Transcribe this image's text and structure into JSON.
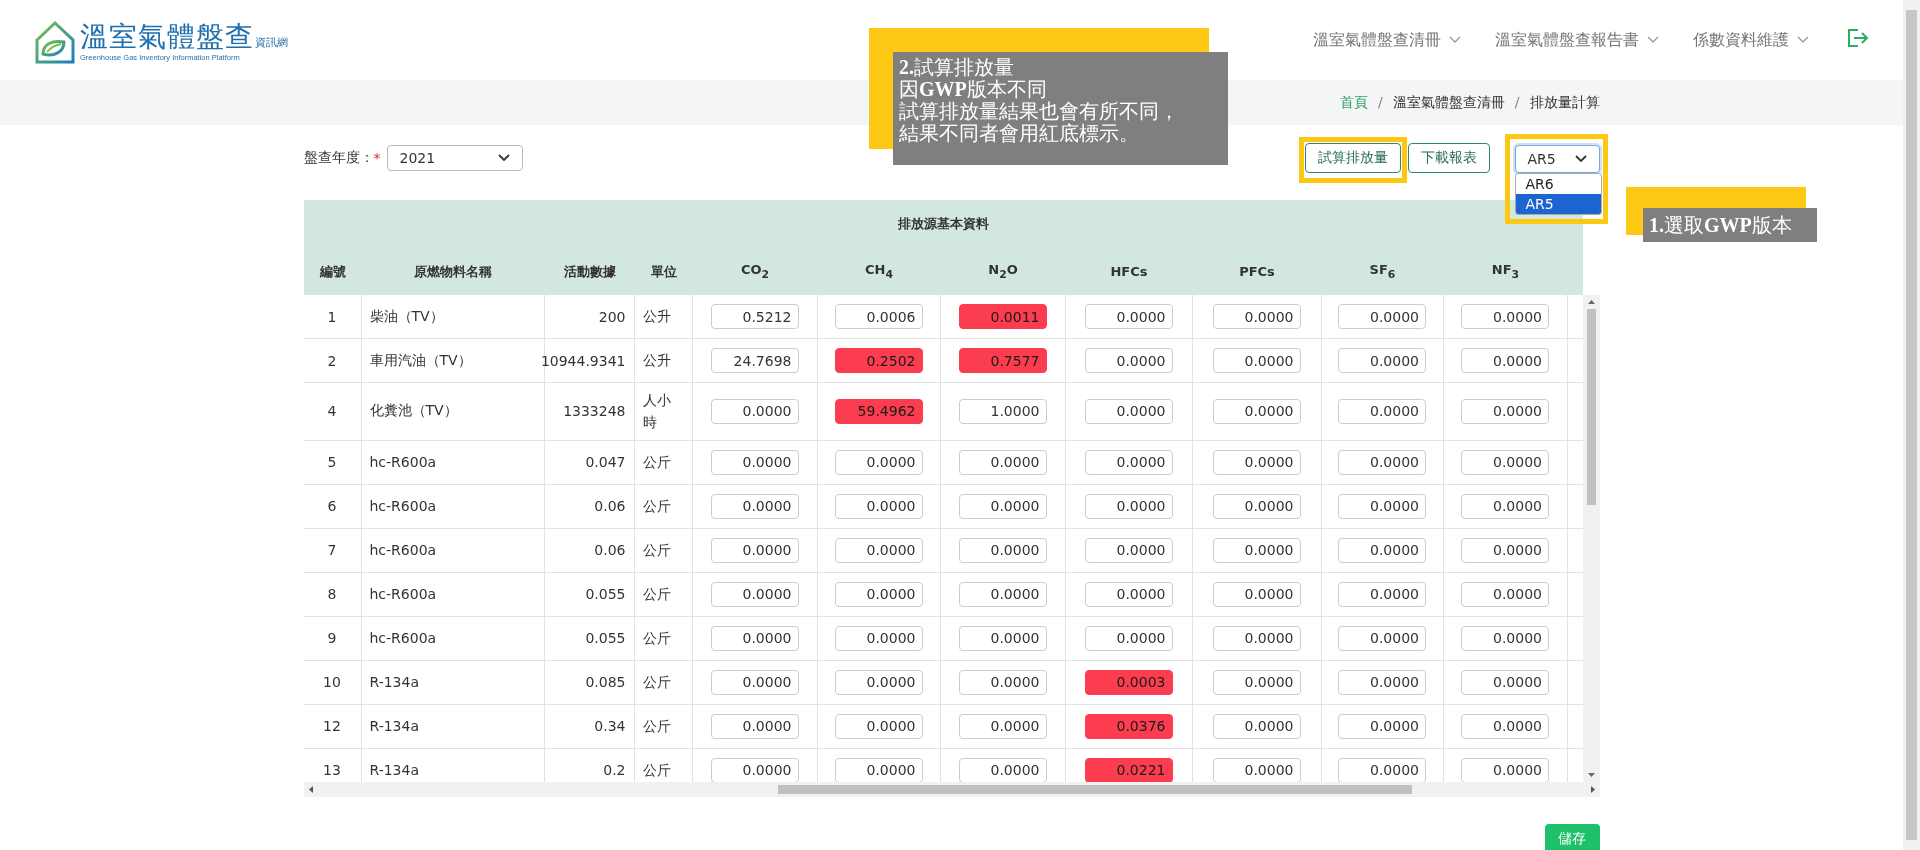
{
  "logo": {
    "title": "溫室氣體盤查",
    "suffix": "資訊網",
    "subtitle": "Greenhouse Gas Inventory Information Platform"
  },
  "nav": [
    {
      "label": "溫室氣體盤查清冊"
    },
    {
      "label": "溫室氣體盤查報告書"
    },
    {
      "label": "係數資料維護"
    }
  ],
  "breadcrumb": [
    {
      "label": "首頁",
      "link": true
    },
    {
      "label": "溫室氣體盤查清冊",
      "link": false
    },
    {
      "label": "排放量計算",
      "link": false
    }
  ],
  "separator": "/",
  "year_filter": {
    "label": "盤查年度：",
    "required_mark": "*",
    "value": "2021"
  },
  "buttons": [
    {
      "label": "試算排放量"
    },
    {
      "label": "下載報表"
    }
  ],
  "gwp_select": {
    "value": "AR5",
    "options": [
      {
        "label": "AR6",
        "selected": false
      },
      {
        "label": "AR5",
        "selected": true
      }
    ]
  },
  "annotations": [
    {
      "lines": [
        "**2.**試算排放量",
        "因**GWP**版本不同",
        "試算排放量結果也會有所不同，",
        "結果不同者會用紅底標示。"
      ]
    },
    {
      "lines": [
        "**1.**選取**GWP**版本"
      ]
    }
  ],
  "table": {
    "group_header": "排放源基本資料",
    "columns": [
      "編號",
      "原燃物料名稱",
      "活動數據",
      "單位",
      "CO$_{2}$",
      "CH$_{4}$",
      "N$_{2}$O",
      "HFCs",
      "PFCs",
      "SF$_{6}$",
      "NF$_{3}$"
    ],
    "rows": [
      {
        "no": "1",
        "material": "柴油（TV）",
        "activity": "200",
        "unit": "公升",
        "values": [
          {
            "value": "0.5212",
            "flagged": false
          },
          {
            "value": "0.0006",
            "flagged": false
          },
          {
            "value": "0.0011",
            "flagged": true
          },
          {
            "value": "0.0000",
            "flagged": false
          },
          {
            "value": "0.0000",
            "flagged": false
          },
          {
            "value": "0.0000",
            "flagged": false
          },
          {
            "value": "0.0000",
            "flagged": false
          }
        ]
      },
      {
        "no": "2",
        "material": "車用汽油（TV）",
        "activity": "10944.9341",
        "unit": "公升",
        "values": [
          {
            "value": "24.7698",
            "flagged": false
          },
          {
            "value": "0.2502",
            "flagged": true
          },
          {
            "value": "0.7577",
            "flagged": true
          },
          {
            "value": "0.0000",
            "flagged": false
          },
          {
            "value": "0.0000",
            "flagged": false
          },
          {
            "value": "0.0000",
            "flagged": false
          },
          {
            "value": "0.0000",
            "flagged": false
          }
        ]
      },
      {
        "no": "4",
        "material": "化糞池（TV）",
        "activity": "1333248",
        "unit": "人小時",
        "values": [
          {
            "value": "0.0000",
            "flagged": false
          },
          {
            "value": "59.4962",
            "flagged": true
          },
          {
            "value": "1.0000",
            "flagged": false
          },
          {
            "value": "0.0000",
            "flagged": false
          },
          {
            "value": "0.0000",
            "flagged": false
          },
          {
            "value": "0.0000",
            "flagged": false
          },
          {
            "value": "0.0000",
            "flagged": false
          }
        ]
      },
      {
        "no": "5",
        "material": "hc-R600a",
        "activity": "0.047",
        "unit": "公斤",
        "values": [
          {
            "value": "0.0000",
            "flagged": false
          },
          {
            "value": "0.0000",
            "flagged": false
          },
          {
            "value": "0.0000",
            "flagged": false
          },
          {
            "value": "0.0000",
            "flagged": false
          },
          {
            "value": "0.0000",
            "flagged": false
          },
          {
            "value": "0.0000",
            "flagged": false
          },
          {
            "value": "0.0000",
            "flagged": false
          }
        ]
      },
      {
        "no": "6",
        "material": "hc-R600a",
        "activity": "0.06",
        "unit": "公斤",
        "values": [
          {
            "value": "0.0000",
            "flagged": false
          },
          {
            "value": "0.0000",
            "flagged": false
          },
          {
            "value": "0.0000",
            "flagged": false
          },
          {
            "value": "0.0000",
            "flagged": false
          },
          {
            "value": "0.0000",
            "flagged": false
          },
          {
            "value": "0.0000",
            "flagged": false
          },
          {
            "value": "0.0000",
            "flagged": false
          }
        ]
      },
      {
        "no": "7",
        "material": "hc-R600a",
        "activity": "0.06",
        "unit": "公斤",
        "values": [
          {
            "value": "0.0000",
            "flagged": false
          },
          {
            "value": "0.0000",
            "flagged": false
          },
          {
            "value": "0.0000",
            "flagged": false
          },
          {
            "value": "0.0000",
            "flagged": false
          },
          {
            "value": "0.0000",
            "flagged": false
          },
          {
            "value": "0.0000",
            "flagged": false
          },
          {
            "value": "0.0000",
            "flagged": false
          }
        ]
      },
      {
        "no": "8",
        "material": "hc-R600a",
        "activity": "0.055",
        "unit": "公斤",
        "values": [
          {
            "value": "0.0000",
            "flagged": false
          },
          {
            "value": "0.0000",
            "flagged": false
          },
          {
            "value": "0.0000",
            "flagged": false
          },
          {
            "value": "0.0000",
            "flagged": false
          },
          {
            "value": "0.0000",
            "flagged": false
          },
          {
            "value": "0.0000",
            "flagged": false
          },
          {
            "value": "0.0000",
            "flagged": false
          }
        ]
      },
      {
        "no": "9",
        "material": "hc-R600a",
        "activity": "0.055",
        "unit": "公斤",
        "values": [
          {
            "value": "0.0000",
            "flagged": false
          },
          {
            "value": "0.0000",
            "flagged": false
          },
          {
            "value": "0.0000",
            "flagged": false
          },
          {
            "value": "0.0000",
            "flagged": false
          },
          {
            "value": "0.0000",
            "flagged": false
          },
          {
            "value": "0.0000",
            "flagged": false
          },
          {
            "value": "0.0000",
            "flagged": false
          }
        ]
      },
      {
        "no": "10",
        "material": "R-134a",
        "activity": "0.085",
        "unit": "公斤",
        "values": [
          {
            "value": "0.0000",
            "flagged": false
          },
          {
            "value": "0.0000",
            "flagged": false
          },
          {
            "value": "0.0000",
            "flagged": false
          },
          {
            "value": "0.0003",
            "flagged": true
          },
          {
            "value": "0.0000",
            "flagged": false
          },
          {
            "value": "0.0000",
            "flagged": false
          },
          {
            "value": "0.0000",
            "flagged": false
          }
        ]
      },
      {
        "no": "12",
        "material": "R-134a",
        "activity": "0.34",
        "unit": "公斤",
        "values": [
          {
            "value": "0.0000",
            "flagged": false
          },
          {
            "value": "0.0000",
            "flagged": false
          },
          {
            "value": "0.0000",
            "flagged": false
          },
          {
            "value": "0.0376",
            "flagged": true
          },
          {
            "value": "0.0000",
            "flagged": false
          },
          {
            "value": "0.0000",
            "flagged": false
          },
          {
            "value": "0.0000",
            "flagged": false
          }
        ]
      },
      {
        "no": "13",
        "material": "R-134a",
        "activity": "0.2",
        "unit": "公斤",
        "values": [
          {
            "value": "0.0000",
            "flagged": false
          },
          {
            "value": "0.0000",
            "flagged": false
          },
          {
            "value": "0.0000",
            "flagged": false
          },
          {
            "value": "0.0221",
            "flagged": true
          },
          {
            "value": "0.0000",
            "flagged": false
          },
          {
            "value": "0.0000",
            "flagged": false
          },
          {
            "value": "0.0000",
            "flagged": false
          }
        ]
      }
    ]
  },
  "save_button": "儲存"
}
